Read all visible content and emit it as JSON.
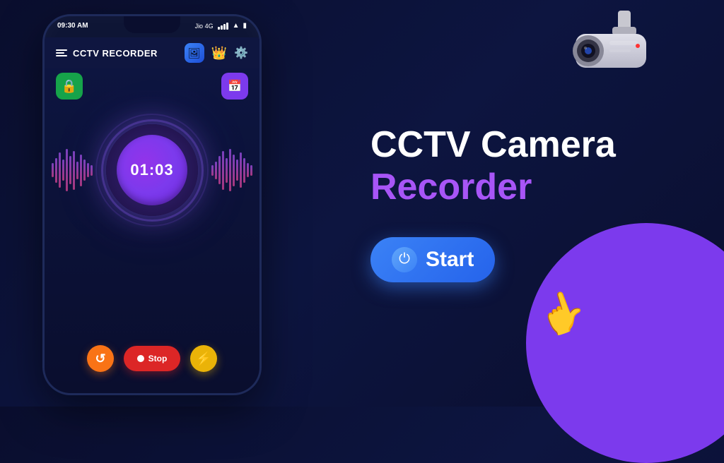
{
  "app": {
    "title": "CCTV RECORDER",
    "status_bar": {
      "time": "09:30 AM",
      "carrier": "Jio 4G"
    },
    "brand": {
      "line1": "CCTV Camera",
      "line2": "Recorder"
    },
    "timer": {
      "display": "01:03"
    },
    "buttons": {
      "stop_label": "Stop",
      "start_label": "Start"
    },
    "icons": {
      "hamburger": "☰",
      "gallery": "🖼",
      "crown": "👑",
      "settings": "⚙",
      "camera_lock": "🔒",
      "schedule": "📅",
      "refresh": "↺",
      "record": "⏺",
      "flash": "⚡",
      "power": "⏻"
    }
  }
}
